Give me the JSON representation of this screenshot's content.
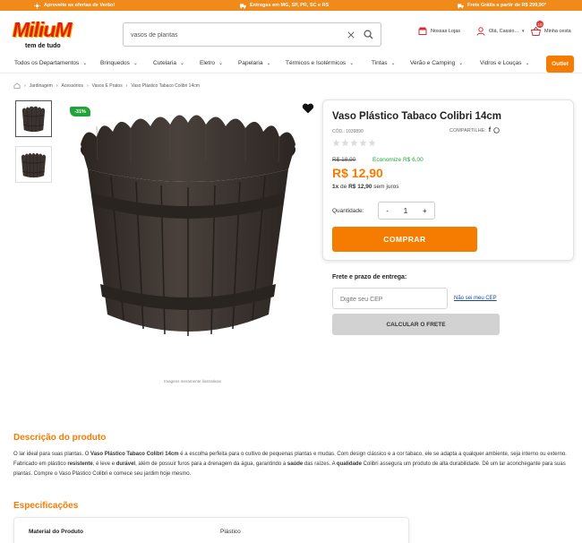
{
  "topbar": {
    "promo_label": "Aproveite as ofertas de Verão!",
    "delivery_label": "Entregas em MG, SP, PR, SC e RS",
    "shipping_label": "Frete Grátis a partir de R$ 299,90*"
  },
  "header": {
    "logo_text": "MiliuM",
    "logo_tagline": "tem de tudo",
    "search_value": "vasos de plantas",
    "stores_label": "Nossas Lojas",
    "account_label": "Olá, Cassio...",
    "cart_label": "Minha cesta",
    "cart_count": "10"
  },
  "nav": {
    "items": [
      "Todos os Departamentos",
      "Brinquedos",
      "Cutelaria",
      "Eletro",
      "Papelaria",
      "Térmicos e Isotérmicos",
      "Tintas",
      "Verão e Camping",
      "Vidros e Louças"
    ],
    "outlet_label": "Outlet"
  },
  "breadcrumb": {
    "items": [
      "Jardinagem",
      "Acessórios",
      "Vasos E Pratos",
      "Vaso Plástico Tabaco Colibri 14cm"
    ]
  },
  "gallery": {
    "discount_badge": "-31%",
    "caption": "Imagens meramente ilustrativas"
  },
  "product": {
    "title": "Vaso Plástico Tabaco Colibri 14cm",
    "sku": "CÓD.: 1039890",
    "share_label": "COMPARTILHE:",
    "rating": 0,
    "old_price": "R$ 18,90",
    "savings": "Economize R$ 6,00",
    "price": "R$ 12,90",
    "installment_count": "1x",
    "installment_of": "de",
    "installment_value": "R$ 12,90",
    "installment_suffix": "sem juros",
    "quantity_label": "Quantidade:",
    "quantity_value": "1",
    "minus": "-",
    "plus": "+",
    "buy_label": "COMPRAR"
  },
  "shipping": {
    "title": "Frete e prazo de entrega:",
    "cep_placeholder": "Digite seu CEP",
    "cep_link": "Não sei meu CEP",
    "calc_label": "CALCULAR O FRETE"
  },
  "description": {
    "title": "Descrição do produto",
    "p1": "O lar ideal para suas plantas. O ",
    "b1": "Vaso Plástico Tabaco Colibri 14cm",
    "p2": " é a escolha perfeita para o cultivo de pequenas plantas e mudas. Com design clássico e a cor tabaco, ele se adapta a qualquer ambiente, seja interno ou externo. Fabricado em plástico ",
    "b2": "resistente",
    "p3": ", é leve e ",
    "b3": "durável",
    "p4": ", além de possuir furos para a drenagem da água, garantindo a ",
    "b4": "saúde",
    "p5": " das raízes. A ",
    "b5": "qualidade",
    "p6": " Colibri assegura um produto de alta durabilidade. Dê um lar aconchegante para suas plantas. Compre o Vaso Plástico Colibri e comece seu jardim hoje mesmo."
  },
  "specs": {
    "title": "Especificações",
    "rows": [
      {
        "key": "Material do Produto",
        "value": "Plástico"
      }
    ]
  },
  "colors": {
    "accent": "#f57c00",
    "topbar": "#f08a1a",
    "discount": "#22a538",
    "pot": "#3a3330"
  }
}
